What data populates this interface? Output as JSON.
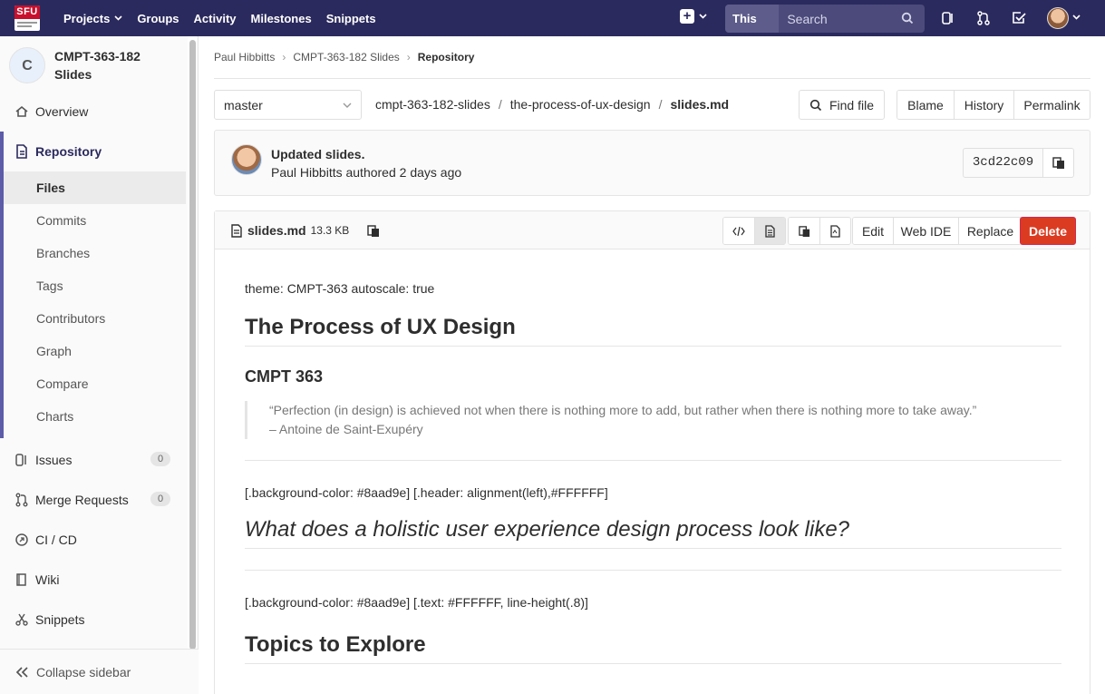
{
  "brand": {
    "logo_text": "SFU",
    "accent": "#2b2a5e",
    "danger": "#db3b21"
  },
  "topnav": {
    "items": [
      "Projects",
      "Groups",
      "Activity",
      "Milestones",
      "Snippets"
    ],
    "search_scope": "This project",
    "search_placeholder": "Search"
  },
  "sidebar": {
    "project_initial": "C",
    "project_name": "CMPT-363-182 Slides",
    "items": {
      "overview": "Overview",
      "repository": "Repository",
      "files": "Files",
      "commits": "Commits",
      "branches": "Branches",
      "tags": "Tags",
      "contributors": "Contributors",
      "graph": "Graph",
      "compare": "Compare",
      "charts": "Charts",
      "issues": "Issues",
      "issues_count": "0",
      "merge_requests": "Merge Requests",
      "merge_requests_count": "0",
      "cicd": "CI / CD",
      "wiki": "Wiki",
      "snippets": "Snippets"
    },
    "collapse": "Collapse sidebar"
  },
  "breadcrumb": [
    "Paul Hibbitts",
    "CMPT-363-182 Slides",
    "Repository"
  ],
  "toolbar": {
    "branch": "master",
    "path": [
      "cmpt-363-182-slides",
      "the-process-of-ux-design",
      "slides.md"
    ],
    "find_file": "Find file",
    "blame": "Blame",
    "history": "History",
    "permalink": "Permalink"
  },
  "commit": {
    "title": "Updated slides.",
    "author": "Paul Hibbitts",
    "authored": "authored",
    "time": "2 days ago",
    "sha": "3cd22c09"
  },
  "file": {
    "name": "slides.md",
    "size": "13.3 KB",
    "edit": "Edit",
    "web_ide": "Web IDE",
    "replace": "Replace",
    "delete": "Delete"
  },
  "markdown": {
    "p1": "theme: CMPT-363 autoscale: true",
    "h1": "The Process of UX Design",
    "h2": "CMPT 363",
    "quote_line1": "“Perfection (in design) is achieved not when there is nothing more to add, but rather when there is nothing more to take away.”",
    "quote_line2": "– Antoine de Saint-Exupéry",
    "p2": "[.background-color: #8aad9e] [.header: alignment(left),#FFFFFF]",
    "h1_italic": "What does a holistic user experience design process look like?",
    "p3": "[.background-color: #8aad9e] [.text: #FFFFFF, line-height(.8)]",
    "h1_topics": "Topics to Explore"
  }
}
